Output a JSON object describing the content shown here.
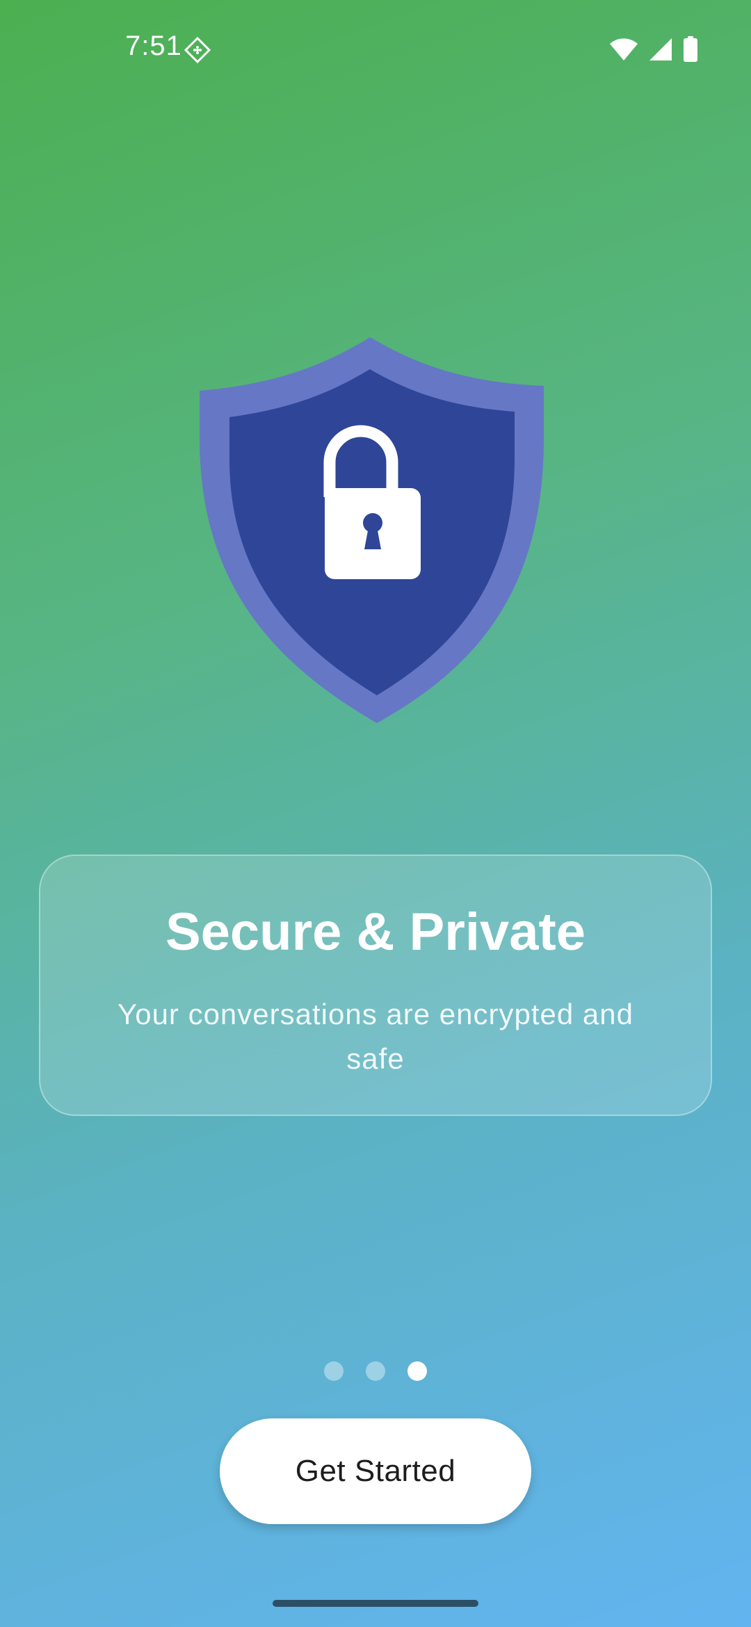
{
  "status_bar": {
    "time": "7:51",
    "app_icon": "notification-app-icon",
    "icons": [
      "wifi-icon",
      "cell-signal-icon",
      "battery-icon"
    ]
  },
  "hero": {
    "icon": "shield-lock-icon",
    "colors": {
      "shield_outer": "#6677c6",
      "shield_inner": "#2e4598",
      "lock": "#ffffff"
    }
  },
  "card": {
    "title": "Secure & Private",
    "subtitle": "Your conversations are encrypted and safe"
  },
  "pager": {
    "total": 3,
    "current": 3
  },
  "cta": {
    "label": "Get Started"
  }
}
